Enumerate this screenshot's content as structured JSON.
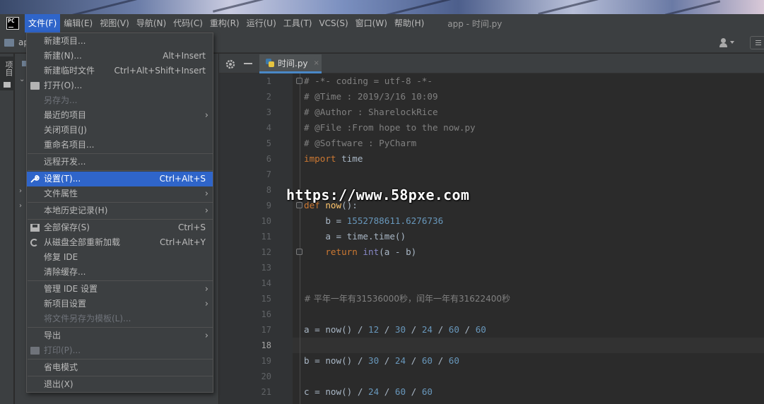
{
  "menubar": {
    "items": [
      "文件(F)",
      "编辑(E)",
      "视图(V)",
      "导航(N)",
      "代码(C)",
      "重构(R)",
      "运行(U)",
      "工具(T)",
      "VCS(S)",
      "窗口(W)",
      "帮助(H)"
    ],
    "window_title": "app - 时间.py",
    "logo": "PC"
  },
  "navbar": {
    "project": "app"
  },
  "stripe": {
    "label": "项目"
  },
  "tab": {
    "name": "时间.py",
    "close": "×"
  },
  "file_menu": {
    "items": [
      {
        "label": "新建项目...",
        "shortcut": ""
      },
      {
        "label": "新建(N)...",
        "shortcut": "Alt+Insert"
      },
      {
        "label": "新建临时文件",
        "shortcut": "Ctrl+Alt+Shift+Insert"
      },
      {
        "label": "打开(O)...",
        "shortcut": ""
      },
      {
        "label": "另存为...",
        "shortcut": ""
      },
      {
        "label": "最近的项目",
        "shortcut": ""
      },
      {
        "label": "关闭项目(J)",
        "shortcut": ""
      },
      {
        "label": "重命名项目...",
        "shortcut": ""
      },
      {
        "label": "远程开发...",
        "shortcut": ""
      },
      {
        "label": "设置(T)...",
        "shortcut": "Ctrl+Alt+S"
      },
      {
        "label": "文件属性",
        "shortcut": ""
      },
      {
        "label": "本地历史记录(H)",
        "shortcut": ""
      },
      {
        "label": "全部保存(S)",
        "shortcut": "Ctrl+S"
      },
      {
        "label": "从磁盘全部重新加载",
        "shortcut": "Ctrl+Alt+Y"
      },
      {
        "label": "修复 IDE",
        "shortcut": ""
      },
      {
        "label": "清除缓存...",
        "shortcut": ""
      },
      {
        "label": "管理 IDE 设置",
        "shortcut": ""
      },
      {
        "label": "新项目设置",
        "shortcut": ""
      },
      {
        "label": "将文件另存为模板(L)...",
        "shortcut": ""
      },
      {
        "label": "导出",
        "shortcut": ""
      },
      {
        "label": "打印(P)...",
        "shortcut": ""
      },
      {
        "label": "省电模式",
        "shortcut": ""
      },
      {
        "label": "退出(X)",
        "shortcut": ""
      }
    ],
    "selected": "设置(T)..."
  },
  "editor": {
    "line_numbers": [
      "1",
      "2",
      "3",
      "4",
      "5",
      "6",
      "7",
      "8",
      "9",
      "10",
      "11",
      "12",
      "13",
      "14",
      "15",
      "16",
      "17",
      "18",
      "19",
      "20",
      "21"
    ],
    "current_line": "18",
    "code": {
      "l1": "# -*- coding = utf-8 -*-",
      "l2": "# @Time : 2019/3/16 10:09",
      "l3": "# @Author : SharelockRice",
      "l4": "# @File :From hope to the now.py",
      "l5": "# @Software : PyCharm",
      "l6_kw": "import",
      "l6_rest": " time",
      "l9_kw": "def",
      "l9_fn": " now",
      "l9_rest": "():",
      "l10_a": "    b = ",
      "l10_num": "1552788611.6276736",
      "l11": "    a = time.time()",
      "l12_kw": "    return",
      "l12_bi": " int",
      "l12_rest": "(a - b)",
      "l15": "# 平年一年有31536000秒，闰年一年有31622400秒",
      "l17_a": "a = now() / ",
      "l17_n1": "12",
      "l17_s1": " / ",
      "l17_n2": "30",
      "l17_s2": " / ",
      "l17_n3": "24",
      "l17_s3": " / ",
      "l17_n4": "60",
      "l17_s4": " / ",
      "l17_n5": "60",
      "l19_a": "b = now() / ",
      "l19_n1": "30",
      "l19_s1": " / ",
      "l19_n2": "24",
      "l19_s2": " / ",
      "l19_n3": "60",
      "l19_s3": " / ",
      "l19_n4": "60",
      "l21_a": "c = now() / ",
      "l21_n1": "24",
      "l21_s1": " / ",
      "l21_n2": "60",
      "l21_s2": " / ",
      "l21_n3": "60"
    }
  },
  "watermark": "https://www.58pxe.com",
  "colors": {
    "accent": "#2f65ca",
    "keyword": "#cc7832",
    "number": "#6897bb",
    "comment": "#808080",
    "function": "#ffc66d"
  }
}
